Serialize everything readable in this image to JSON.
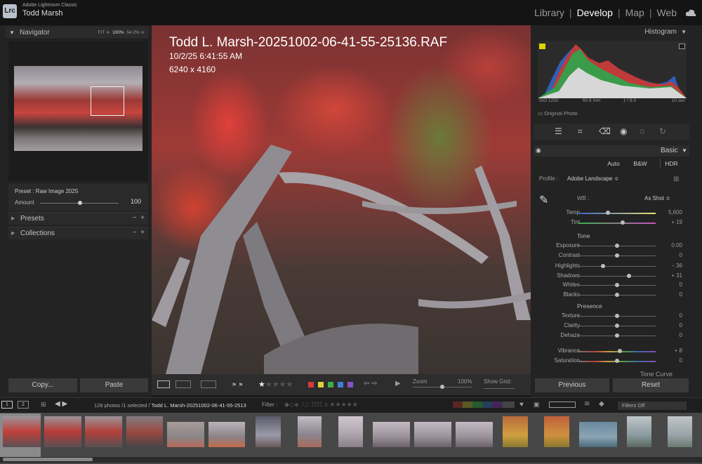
{
  "app": {
    "name": "Adobe Lightroom Classic",
    "user": "Todd Marsh",
    "logo": "Lrc"
  },
  "modules": [
    {
      "label": "Library",
      "active": false
    },
    {
      "label": "Develop",
      "active": true
    },
    {
      "label": "Map",
      "active": false
    },
    {
      "label": "Web",
      "active": false
    }
  ],
  "navigator": {
    "title": "Navigator",
    "fit": "FIT ≑",
    "z1": "100%",
    "z2": "54.2% ≑"
  },
  "preset": {
    "label": "Preset : Raw Image 2025",
    "amount_label": "Amount",
    "amount_value": "100"
  },
  "panels": {
    "presets": "Presets",
    "collections": "Collections"
  },
  "left_buttons": {
    "copy": "Copy...",
    "paste": "Paste"
  },
  "photo": {
    "filename": "Todd L. Marsh-20251002-06-41-55-25136.RAF",
    "datetime": "10/2/25 6:41:55 AM",
    "dimensions": "6240 x 4160"
  },
  "toolbar": {
    "zoom_label": "Zoom",
    "zoom_value": "100%",
    "show_grid": "Show Grid:"
  },
  "histogram": {
    "title": "Histogram",
    "iso": "ISO 1250",
    "focal": "60.8 mm",
    "aperture": "ƒ / 8.0",
    "shutter": "10 sec",
    "original": "Original Photo"
  },
  "basic": {
    "title": "Basic",
    "buttons": [
      "Auto",
      "B&W",
      "HDR"
    ],
    "profile_label": "Profile :",
    "profile_value": "Adobe Landscape ≑",
    "wb_label": "WB :",
    "wb_value": "As Shot ≑",
    "tone_label": "Tone",
    "presence_label": "Presence",
    "tone_curve": "Tone Curve"
  },
  "sliders": [
    {
      "name": "Temp",
      "value": "5,600",
      "pos": 0.38
    },
    {
      "name": "Tint",
      "value": "+ 19",
      "pos": 0.57
    },
    {
      "name": "Exposure",
      "value": "0.00",
      "pos": 0.5
    },
    {
      "name": "Contrast",
      "value": "0",
      "pos": 0.5
    },
    {
      "name": "Highlights",
      "value": "− 36",
      "pos": 0.32
    },
    {
      "name": "Shadows",
      "value": "+ 31",
      "pos": 0.65
    },
    {
      "name": "Whites",
      "value": "0",
      "pos": 0.5
    },
    {
      "name": "Blacks",
      "value": "0",
      "pos": 0.5
    },
    {
      "name": "Texture",
      "value": "0",
      "pos": 0.5
    },
    {
      "name": "Clarity",
      "value": "0",
      "pos": 0.5
    },
    {
      "name": "Dehaze",
      "value": "0",
      "pos": 0.5
    },
    {
      "name": "Vibrance",
      "value": "+ 8",
      "pos": 0.54
    },
    {
      "name": "Saturation",
      "value": "0",
      "pos": 0.5
    }
  ],
  "right_buttons": {
    "previous": "Previous",
    "reset": "Reset"
  },
  "filmstrip": {
    "screen1": "1",
    "screen2": "2",
    "info": "128 photos /1 selected /",
    "current": "Todd L. Marsh-20251002-06-41-55-2513",
    "filter_label": "Filter :",
    "filters_value": "Filters Off"
  },
  "label_colors": [
    "#d43b3b",
    "#d9d23a",
    "#3fae48",
    "#3f7fd9",
    "#8b4fc9"
  ]
}
